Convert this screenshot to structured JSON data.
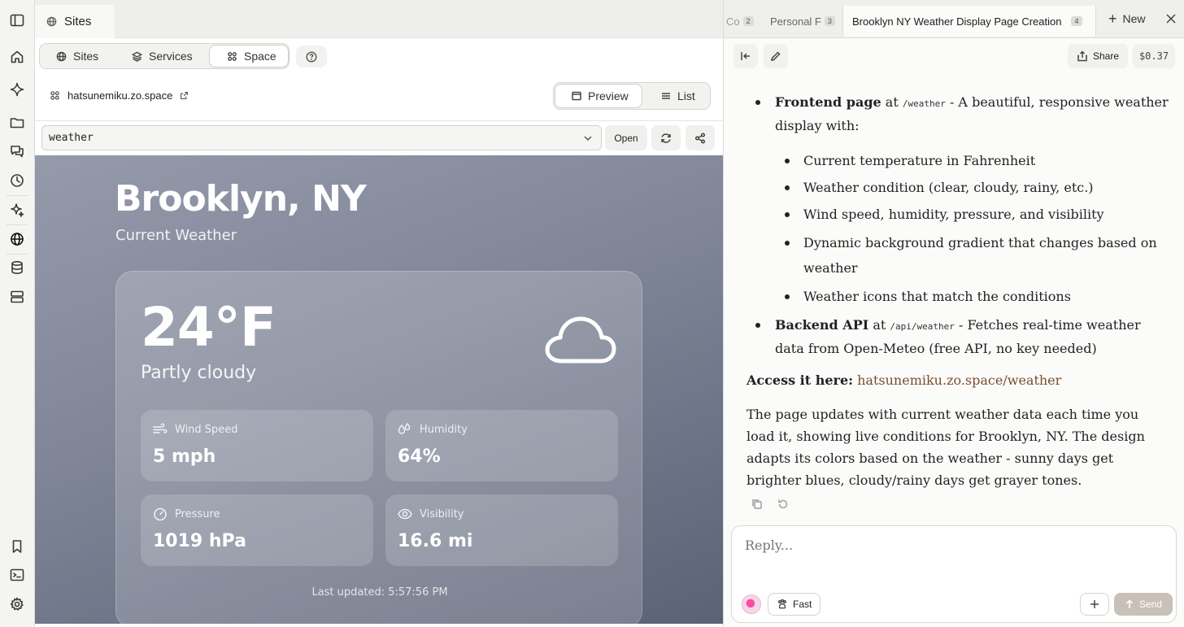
{
  "sites_tab": {
    "label": "Sites"
  },
  "segments": [
    {
      "label": "Sites",
      "icon": "globe-icon"
    },
    {
      "label": "Services",
      "icon": "layers-icon"
    },
    {
      "label": "Space",
      "icon": "grid-icon",
      "active": true
    }
  ],
  "domain": {
    "label": "hatsunemiku.zo.space"
  },
  "view_toggle": [
    {
      "label": "Preview",
      "active": true
    },
    {
      "label": "List"
    }
  ],
  "path": {
    "value": "weather"
  },
  "open_label": "Open",
  "weather": {
    "city": "Brooklyn, NY",
    "subtitle": "Current Weather",
    "temperature": "24°F",
    "condition": "Partly cloudy",
    "stats": [
      {
        "label": "Wind Speed",
        "value": "5 mph",
        "icon": "wind-icon"
      },
      {
        "label": "Humidity",
        "value": "64%",
        "icon": "droplets-icon"
      },
      {
        "label": "Pressure",
        "value": "1019 hPa",
        "icon": "gauge-icon"
      },
      {
        "label": "Visibility",
        "value": "16.6 mi",
        "icon": "eye-icon"
      }
    ],
    "updated": "Last updated: 5:57:56 PM"
  },
  "right_tabs": [
    {
      "label": "Co",
      "num": "2"
    },
    {
      "label": "Personal F",
      "num": "3"
    },
    {
      "label": "Brooklyn NY Weather Display Page Creation",
      "num": "4",
      "active": true
    }
  ],
  "new_tab_label": "New",
  "share_label": "Share",
  "cost": "$0.37",
  "message": {
    "frontend_title": "Frontend page",
    "frontend_at": "at",
    "frontend_path": "/weather",
    "frontend_desc": "- A beautiful, responsive weather display with:",
    "features": [
      "Current temperature in Fahrenheit",
      "Weather condition (clear, cloudy, rainy, etc.)",
      "Wind speed, humidity, pressure, and visibility",
      "Dynamic background gradient that changes based on weather",
      "Weather icons that match the conditions"
    ],
    "backend_title": "Backend API",
    "backend_at": "at",
    "backend_path": "/api/weather",
    "backend_desc": "- Fetches real-time weather data from Open-Meteo (free API, no key needed)",
    "access_label": "Access it here:",
    "access_link": "hatsunemiku.zo.space/weather",
    "summary": "The page updates with current weather data each time you load it, showing live conditions for Brooklyn, NY. The design adapts its colors based on the weather - sunny days get brighter blues, cloudy/rainy days get grayer tones."
  },
  "reply": {
    "placeholder": "Reply..."
  },
  "fast_label": "Fast",
  "send_label": "Send",
  "colors": {
    "accent_link": "#7a4e2e",
    "send_button": "#c9c0b9"
  }
}
